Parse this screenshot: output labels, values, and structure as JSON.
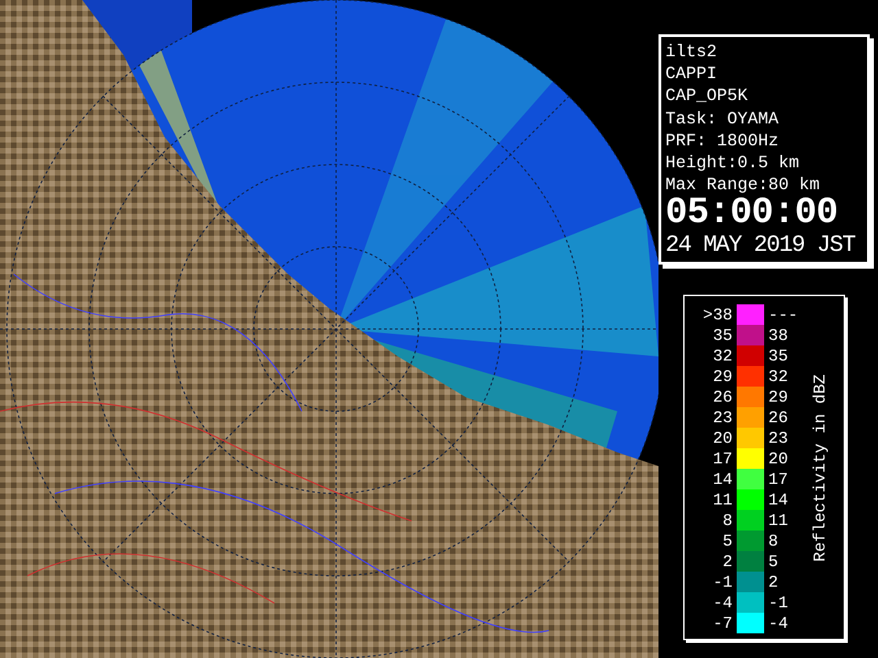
{
  "info": {
    "lines": [
      "ilts2",
      "CAPPI",
      "CAP_OP5K",
      "Task: OYAMA",
      "PRF: 1800Hz",
      "Height:0.5 km",
      "Max Range:80 km"
    ],
    "time": "05:00:00",
    "date": "24 MAY 2019 JST"
  },
  "legend": {
    "title": "Reflectivity in dBZ",
    "rows": [
      {
        "low": ">38",
        "high": "---",
        "color": "#ff20ff"
      },
      {
        "low": "35",
        "high": "38",
        "color": "#c0108a"
      },
      {
        "low": "32",
        "high": "35",
        "color": "#d00000"
      },
      {
        "low": "29",
        "high": "32",
        "color": "#ff3000"
      },
      {
        "low": "26",
        "high": "29",
        "color": "#ff7800"
      },
      {
        "low": "23",
        "high": "26",
        "color": "#ffa000"
      },
      {
        "low": "20",
        "high": "23",
        "color": "#ffc800"
      },
      {
        "low": "17",
        "high": "20",
        "color": "#ffff00"
      },
      {
        "low": "14",
        "high": "17",
        "color": "#40ff40"
      },
      {
        "low": "11",
        "high": "14",
        "color": "#00ff00"
      },
      {
        "low": "8",
        "high": "11",
        "color": "#00d020"
      },
      {
        "low": "5",
        "high": "8",
        "color": "#009a30"
      },
      {
        "low": "2",
        "high": "5",
        "color": "#008040"
      },
      {
        "low": "-1",
        "high": "2",
        "color": "#009090"
      },
      {
        "low": "-4",
        "high": "-1",
        "color": "#00c0c0"
      },
      {
        "low": "-7",
        "high": "-4",
        "color": "#00ffff"
      }
    ]
  }
}
